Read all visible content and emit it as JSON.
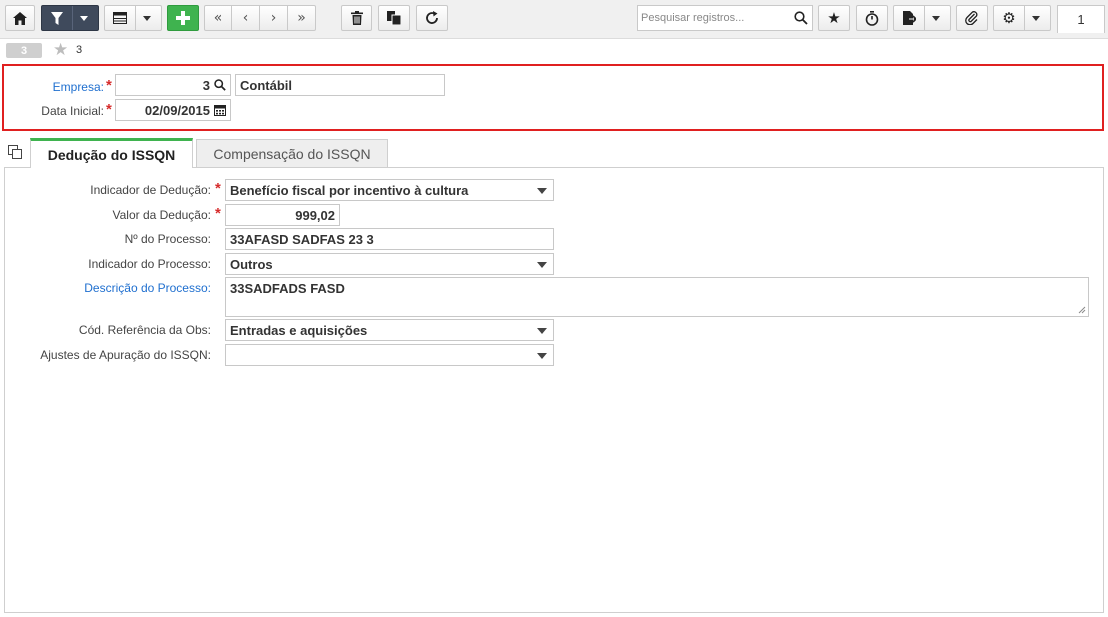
{
  "toolbar": {
    "search_placeholder": "Pesquisar registros...",
    "page_number": "1"
  },
  "record": {
    "badge": "3",
    "number": "3"
  },
  "header": {
    "empresa_label": "Empresa:",
    "empresa_code": "3",
    "empresa_name": "Contábil",
    "data_label": "Data Inicial:",
    "data_value": "02/09/2015"
  },
  "tabs": [
    {
      "label": "Dedução do ISSQN"
    },
    {
      "label": "Compensação do ISSQN"
    }
  ],
  "form": {
    "indicador_deducao_label": "Indicador de Dedução:",
    "indicador_deducao_value": "Benefício fiscal por incentivo à cultura",
    "valor_deducao_label": "Valor da Dedução:",
    "valor_deducao_value": "999,02",
    "num_processo_label": "Nº do Processo:",
    "num_processo_value": "33AFASD SADFAS 23 3",
    "indicador_processo_label": "Indicador do Processo:",
    "indicador_processo_value": "Outros",
    "descricao_processo_label": "Descrição do Processo:",
    "descricao_processo_value": "33SADFADS FASD",
    "cod_ref_label": "Cód. Referência da Obs:",
    "cod_ref_value": "Entradas e aquisições",
    "ajustes_label": "Ajustes de Apuração do ISSQN:",
    "ajustes_value": ""
  },
  "colors": {
    "accent_green": "#3fb34f",
    "toolbar_dark": "#3f4a5c",
    "highlight_red": "#e02020",
    "link_blue": "#1f6fcf",
    "required_red": "#d62b2b"
  },
  "icons": [
    "home-icon",
    "filter-icon",
    "grid-icon",
    "plus-icon",
    "first-page-icon",
    "prev-page-icon",
    "next-page-icon",
    "last-page-icon",
    "trash-icon",
    "copy-icon",
    "refresh-icon",
    "search-icon",
    "star-icon",
    "timer-icon",
    "export-icon",
    "paperclip-icon",
    "gear-icon",
    "calendar-icon"
  ]
}
